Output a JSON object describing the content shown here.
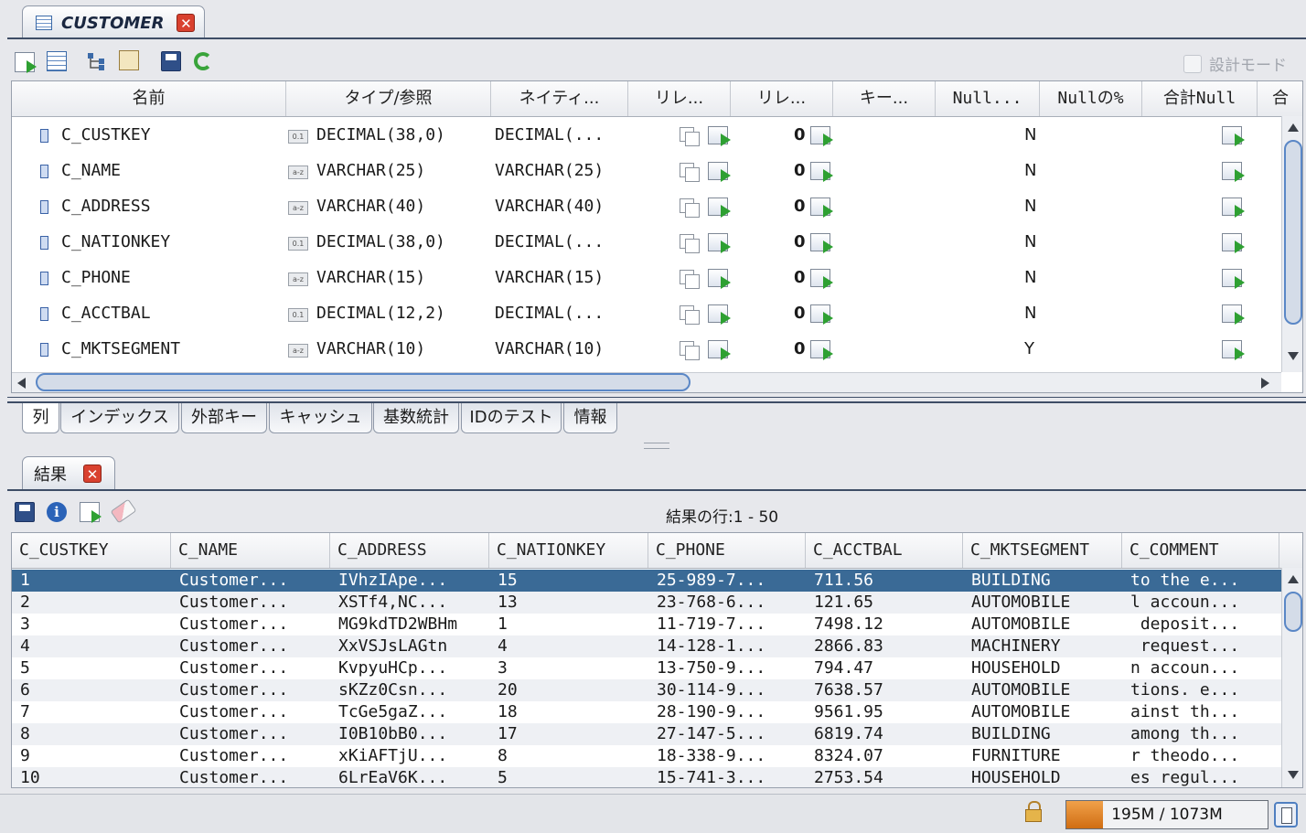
{
  "editor_tab": {
    "title": "CUSTOMER",
    "close": "✕"
  },
  "design_mode": {
    "label": "設計モード",
    "checked": false
  },
  "columns_table": {
    "headers": [
      "名前",
      "タイプ/参照",
      "ネイティ...",
      "リレ...",
      "リレ...",
      "キー...",
      "Null...",
      "Nullの%",
      "合計Null",
      "合"
    ],
    "rows": [
      {
        "name": "C_CUSTKEY",
        "badge": "0.1",
        "type": "DECIMAL(38,0)",
        "native": "DECIMAL(...",
        "rel2": "0",
        "null": "N"
      },
      {
        "name": "C_NAME",
        "badge": "a-z",
        "type": "VARCHAR(25)",
        "native": "VARCHAR(25)",
        "rel2": "0",
        "null": "N"
      },
      {
        "name": "C_ADDRESS",
        "badge": "a-z",
        "type": "VARCHAR(40)",
        "native": "VARCHAR(40)",
        "rel2": "0",
        "null": "N"
      },
      {
        "name": "C_NATIONKEY",
        "badge": "0.1",
        "type": "DECIMAL(38,0)",
        "native": "DECIMAL(...",
        "rel2": "0",
        "null": "N"
      },
      {
        "name": "C_PHONE",
        "badge": "a-z",
        "type": "VARCHAR(15)",
        "native": "VARCHAR(15)",
        "rel2": "0",
        "null": "N"
      },
      {
        "name": "C_ACCTBAL",
        "badge": "0.1",
        "type": "DECIMAL(12,2)",
        "native": "DECIMAL(...",
        "rel2": "0",
        "null": "N"
      },
      {
        "name": "C_MKTSEGMENT",
        "badge": "a-z",
        "type": "VARCHAR(10)",
        "native": "VARCHAR(10)",
        "rel2": "0",
        "null": "Y"
      }
    ]
  },
  "bottom_tabs": [
    "列",
    "インデックス",
    "外部キー",
    "キャッシュ",
    "基数統計",
    "IDのテスト",
    "情報"
  ],
  "results_tab": {
    "title": "結果",
    "close": "✕"
  },
  "results_info": "結果の行:1 - 50",
  "results_table": {
    "headers": [
      "C_CUSTKEY",
      "C_NAME",
      "C_ADDRESS",
      "C_NATIONKEY",
      "C_PHONE",
      "C_ACCTBAL",
      "C_MKTSEGMENT",
      "C_COMMENT"
    ],
    "rows": [
      [
        "1",
        "Customer...",
        "IVhzIApe...",
        "15",
        "25-989-7...",
        "711.56",
        "BUILDING",
        "to the e..."
      ],
      [
        "2",
        "Customer...",
        "XSTf4,NC...",
        "13",
        "23-768-6...",
        "121.65",
        "AUTOMOBILE",
        "l accoun..."
      ],
      [
        "3",
        "Customer...",
        "MG9kdTD2WBHm",
        "1",
        "11-719-7...",
        "7498.12",
        "AUTOMOBILE",
        " deposit..."
      ],
      [
        "4",
        "Customer...",
        "XxVSJsLAGtn",
        "4",
        "14-128-1...",
        "2866.83",
        "MACHINERY",
        " request..."
      ],
      [
        "5",
        "Customer...",
        "KvpyuHCp...",
        "3",
        "13-750-9...",
        "794.47",
        "HOUSEHOLD",
        "n accoun..."
      ],
      [
        "6",
        "Customer...",
        "sKZz0Csn...",
        "20",
        "30-114-9...",
        "7638.57",
        "AUTOMOBILE",
        "tions. e..."
      ],
      [
        "7",
        "Customer...",
        "TcGe5gaZ...",
        "18",
        "28-190-9...",
        "9561.95",
        "AUTOMOBILE",
        "ainst th..."
      ],
      [
        "8",
        "Customer...",
        "I0B10bB0...",
        "17",
        "27-147-5...",
        "6819.74",
        "BUILDING",
        "among th..."
      ],
      [
        "9",
        "Customer...",
        "xKiAFTjU...",
        "8",
        "18-338-9...",
        "8324.07",
        "FURNITURE",
        "r theodo..."
      ],
      [
        "10",
        "Customer...",
        "6LrEaV6K...",
        "5",
        "15-741-3...",
        "2753.54",
        "HOUSEHOLD",
        "es regul..."
      ]
    ]
  },
  "memory": {
    "label": "195M / 1073M",
    "used_fraction": 0.18
  },
  "colors": {
    "selection": "#3a6a96",
    "accent": "#d06d12",
    "close": "#d9412f"
  }
}
